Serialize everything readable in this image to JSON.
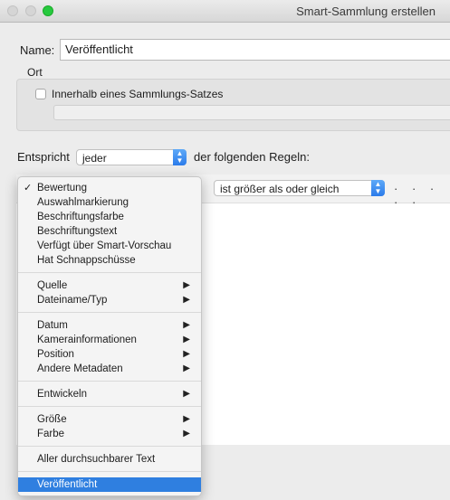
{
  "window": {
    "title": "Smart-Sammlung erstellen"
  },
  "form": {
    "name_label": "Name:",
    "name_value": "Veröffentlicht",
    "location_label": "Ort",
    "inside_set_label": "Innerhalb eines Sammlungs-Satzes",
    "match_label": "Entspricht",
    "match_value": "jeder",
    "rules_suffix": "der folgenden Regeln:"
  },
  "rule": {
    "operator_value": "ist größer als oder gleich",
    "dots": "· · · · ·"
  },
  "menu": {
    "checkmark": "✓",
    "submenu_arrow": "▶",
    "items": [
      {
        "label": "Bewertung",
        "checked": true
      },
      {
        "label": "Auswahlmarkierung"
      },
      {
        "label": "Beschriftungsfarbe"
      },
      {
        "label": "Beschriftungstext"
      },
      {
        "label": "Verfügt über Smart-Vorschau"
      },
      {
        "label": "Hat Schnappschüsse"
      },
      {
        "label": "Quelle",
        "submenu": true
      },
      {
        "label": "Dateiname/Typ",
        "submenu": true
      },
      {
        "label": "Datum",
        "submenu": true
      },
      {
        "label": "Kamerainformationen",
        "submenu": true
      },
      {
        "label": "Position",
        "submenu": true
      },
      {
        "label": "Andere Metadaten",
        "submenu": true
      },
      {
        "label": "Entwickeln",
        "submenu": true
      },
      {
        "label": "Größe",
        "submenu": true
      },
      {
        "label": "Farbe",
        "submenu": true
      },
      {
        "label": "Aller durchsuchbarer Text"
      },
      {
        "label": "Veröffentlicht",
        "selected": true
      }
    ]
  },
  "colors": {
    "accent": "#2f7fe0",
    "window_bg": "#ececec"
  }
}
